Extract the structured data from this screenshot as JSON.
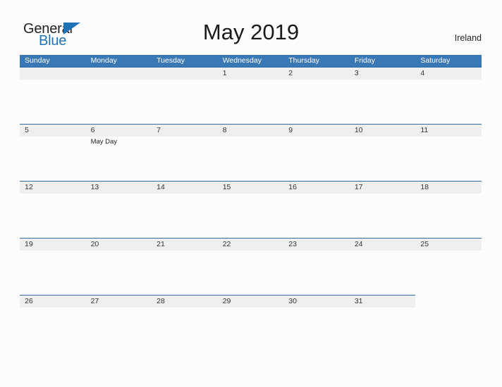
{
  "brand": {
    "name_part1": "General",
    "name_part2": "Blue",
    "triangle_color": "#1f72b5"
  },
  "header": {
    "title": "May 2019",
    "region": "Ireland"
  },
  "theme": {
    "header_blue": "#3a77b5",
    "band_gray": "#efefef",
    "band_line": "#2c6ca8",
    "page_background": "#fcfcfd",
    "text_color": "#333333"
  },
  "calendar": {
    "month": "May",
    "year": "2019",
    "weekday_headers": [
      "Sunday",
      "Monday",
      "Tuesday",
      "Wednesday",
      "Thursday",
      "Friday",
      "Saturday"
    ],
    "weeks": [
      {
        "band_columns": 7,
        "days": [
          {
            "number": "",
            "event": ""
          },
          {
            "number": "",
            "event": ""
          },
          {
            "number": "",
            "event": ""
          },
          {
            "number": "1",
            "event": ""
          },
          {
            "number": "2",
            "event": ""
          },
          {
            "number": "3",
            "event": ""
          },
          {
            "number": "4",
            "event": ""
          }
        ]
      },
      {
        "band_columns": 7,
        "days": [
          {
            "number": "5",
            "event": ""
          },
          {
            "number": "6",
            "event": "May Day"
          },
          {
            "number": "7",
            "event": ""
          },
          {
            "number": "8",
            "event": ""
          },
          {
            "number": "9",
            "event": ""
          },
          {
            "number": "10",
            "event": ""
          },
          {
            "number": "11",
            "event": ""
          }
        ]
      },
      {
        "band_columns": 7,
        "days": [
          {
            "number": "12",
            "event": ""
          },
          {
            "number": "13",
            "event": ""
          },
          {
            "number": "14",
            "event": ""
          },
          {
            "number": "15",
            "event": ""
          },
          {
            "number": "16",
            "event": ""
          },
          {
            "number": "17",
            "event": ""
          },
          {
            "number": "18",
            "event": ""
          }
        ]
      },
      {
        "band_columns": 7,
        "days": [
          {
            "number": "19",
            "event": ""
          },
          {
            "number": "20",
            "event": ""
          },
          {
            "number": "21",
            "event": ""
          },
          {
            "number": "22",
            "event": ""
          },
          {
            "number": "23",
            "event": ""
          },
          {
            "number": "24",
            "event": ""
          },
          {
            "number": "25",
            "event": ""
          }
        ]
      },
      {
        "band_columns": 6,
        "days": [
          {
            "number": "26",
            "event": ""
          },
          {
            "number": "27",
            "event": ""
          },
          {
            "number": "28",
            "event": ""
          },
          {
            "number": "29",
            "event": ""
          },
          {
            "number": "30",
            "event": ""
          },
          {
            "number": "31",
            "event": ""
          },
          {
            "number": "",
            "event": ""
          }
        ]
      }
    ]
  }
}
